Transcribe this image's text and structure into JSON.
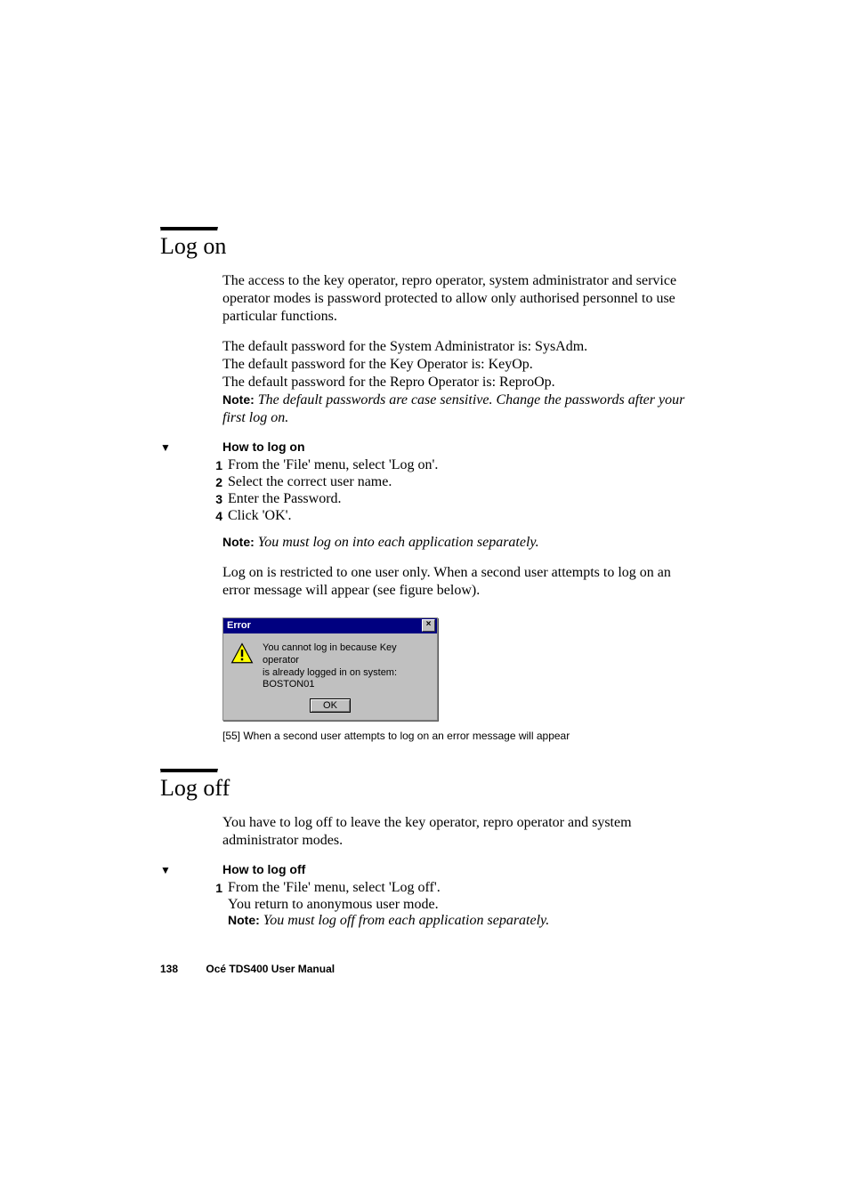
{
  "sections": {
    "logon": {
      "heading": "Log on",
      "intro": "The access to the key operator, repro operator, system administrator and service operator modes is password protected to allow only authorised personnel to use particular functions.",
      "pw_sysadmin": "The default password for the System Administrator is: SysAdm.",
      "pw_keyop": "The default password for the Key Operator is: KeyOp.",
      "pw_reproop": "The default password for the Repro Operator is: ReproOp.",
      "note_label": "Note:",
      "note_text": "The default passwords are case sensitive. Change the passwords after your first log on.",
      "proc_title": "How to log on",
      "steps": {
        "s1": "From the 'File' menu, select 'Log on'.",
        "s2": "Select the correct user name.",
        "s3": "Enter the Password.",
        "s4": "Click 'OK'."
      },
      "note2_label": "Note:",
      "note2_text": "You must log on into each application separately.",
      "restrict": "Log on is restricted to one user only. When a second user attempts to log on an error message will appear (see figure below).",
      "dialog": {
        "title": "Error",
        "msg1": "You cannot log in because Key operator",
        "msg2": "is already logged in on system: BOSTON01",
        "ok": "OK"
      },
      "caption": "[55] When a second user attempts to log on an error message will appear"
    },
    "logoff": {
      "heading": "Log off",
      "intro": "You have to log off to leave the key operator, repro operator and system administrator modes.",
      "proc_title": "How to log off",
      "step1": "From the 'File' menu, select 'Log off'.",
      "step1_sub": "You return to anonymous user mode.",
      "note_label": "Note:",
      "note_text": "You must log off from each application separately."
    }
  },
  "nums": {
    "n1": "1",
    "n2": "2",
    "n3": "3",
    "n4": "4"
  },
  "footer": {
    "page": "138",
    "title": "Océ TDS400 User Manual"
  }
}
